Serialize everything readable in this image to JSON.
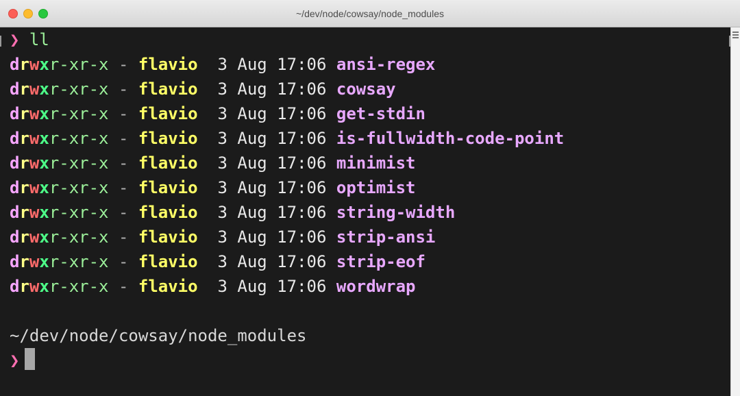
{
  "window": {
    "title": "~/dev/node/cowsay/node_modules"
  },
  "terminal": {
    "prompt_symbol": "❯",
    "command": "ll",
    "entries": [
      {
        "permissions": [
          "d",
          "r",
          "w",
          "x",
          "r-xr-x"
        ],
        "separator": "-",
        "owner": "flavio",
        "date": "3 Aug 17:06",
        "name": "ansi-regex"
      },
      {
        "permissions": [
          "d",
          "r",
          "w",
          "x",
          "r-xr-x"
        ],
        "separator": "-",
        "owner": "flavio",
        "date": "3 Aug 17:06",
        "name": "cowsay"
      },
      {
        "permissions": [
          "d",
          "r",
          "w",
          "x",
          "r-xr-x"
        ],
        "separator": "-",
        "owner": "flavio",
        "date": "3 Aug 17:06",
        "name": "get-stdin"
      },
      {
        "permissions": [
          "d",
          "r",
          "w",
          "x",
          "r-xr-x"
        ],
        "separator": "-",
        "owner": "flavio",
        "date": "3 Aug 17:06",
        "name": "is-fullwidth-code-point"
      },
      {
        "permissions": [
          "d",
          "r",
          "w",
          "x",
          "r-xr-x"
        ],
        "separator": "-",
        "owner": "flavio",
        "date": "3 Aug 17:06",
        "name": "minimist"
      },
      {
        "permissions": [
          "d",
          "r",
          "w",
          "x",
          "r-xr-x"
        ],
        "separator": "-",
        "owner": "flavio",
        "date": "3 Aug 17:06",
        "name": "optimist"
      },
      {
        "permissions": [
          "d",
          "r",
          "w",
          "x",
          "r-xr-x"
        ],
        "separator": "-",
        "owner": "flavio",
        "date": "3 Aug 17:06",
        "name": "string-width"
      },
      {
        "permissions": [
          "d",
          "r",
          "w",
          "x",
          "r-xr-x"
        ],
        "separator": "-",
        "owner": "flavio",
        "date": "3 Aug 17:06",
        "name": "strip-ansi"
      },
      {
        "permissions": [
          "d",
          "r",
          "w",
          "x",
          "r-xr-x"
        ],
        "separator": "-",
        "owner": "flavio",
        "date": "3 Aug 17:06",
        "name": "strip-eof"
      },
      {
        "permissions": [
          "d",
          "r",
          "w",
          "x",
          "r-xr-x"
        ],
        "separator": "-",
        "owner": "flavio",
        "date": "3 Aug 17:06",
        "name": "wordwrap"
      }
    ],
    "cwd": "~/dev/node/cowsay/node_modules",
    "colors": {
      "background": "#1b1b1b",
      "prompt": "#ff6fb1",
      "command": "#9cf09a",
      "owner": "#ffff66",
      "name": "#e8a8ff"
    }
  }
}
